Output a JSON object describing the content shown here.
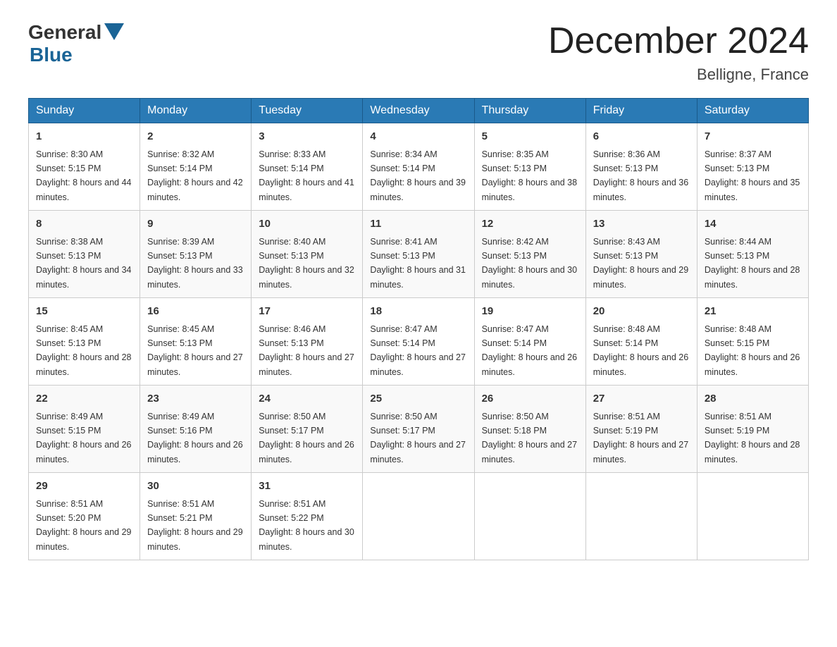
{
  "logo": {
    "general": "General",
    "blue": "Blue"
  },
  "header": {
    "title": "December 2024",
    "subtitle": "Belligne, France"
  },
  "days_of_week": [
    "Sunday",
    "Monday",
    "Tuesday",
    "Wednesday",
    "Thursday",
    "Friday",
    "Saturday"
  ],
  "weeks": [
    [
      {
        "day": "1",
        "sunrise": "Sunrise: 8:30 AM",
        "sunset": "Sunset: 5:15 PM",
        "daylight": "Daylight: 8 hours and 44 minutes."
      },
      {
        "day": "2",
        "sunrise": "Sunrise: 8:32 AM",
        "sunset": "Sunset: 5:14 PM",
        "daylight": "Daylight: 8 hours and 42 minutes."
      },
      {
        "day": "3",
        "sunrise": "Sunrise: 8:33 AM",
        "sunset": "Sunset: 5:14 PM",
        "daylight": "Daylight: 8 hours and 41 minutes."
      },
      {
        "day": "4",
        "sunrise": "Sunrise: 8:34 AM",
        "sunset": "Sunset: 5:14 PM",
        "daylight": "Daylight: 8 hours and 39 minutes."
      },
      {
        "day": "5",
        "sunrise": "Sunrise: 8:35 AM",
        "sunset": "Sunset: 5:13 PM",
        "daylight": "Daylight: 8 hours and 38 minutes."
      },
      {
        "day": "6",
        "sunrise": "Sunrise: 8:36 AM",
        "sunset": "Sunset: 5:13 PM",
        "daylight": "Daylight: 8 hours and 36 minutes."
      },
      {
        "day": "7",
        "sunrise": "Sunrise: 8:37 AM",
        "sunset": "Sunset: 5:13 PM",
        "daylight": "Daylight: 8 hours and 35 minutes."
      }
    ],
    [
      {
        "day": "8",
        "sunrise": "Sunrise: 8:38 AM",
        "sunset": "Sunset: 5:13 PM",
        "daylight": "Daylight: 8 hours and 34 minutes."
      },
      {
        "day": "9",
        "sunrise": "Sunrise: 8:39 AM",
        "sunset": "Sunset: 5:13 PM",
        "daylight": "Daylight: 8 hours and 33 minutes."
      },
      {
        "day": "10",
        "sunrise": "Sunrise: 8:40 AM",
        "sunset": "Sunset: 5:13 PM",
        "daylight": "Daylight: 8 hours and 32 minutes."
      },
      {
        "day": "11",
        "sunrise": "Sunrise: 8:41 AM",
        "sunset": "Sunset: 5:13 PM",
        "daylight": "Daylight: 8 hours and 31 minutes."
      },
      {
        "day": "12",
        "sunrise": "Sunrise: 8:42 AM",
        "sunset": "Sunset: 5:13 PM",
        "daylight": "Daylight: 8 hours and 30 minutes."
      },
      {
        "day": "13",
        "sunrise": "Sunrise: 8:43 AM",
        "sunset": "Sunset: 5:13 PM",
        "daylight": "Daylight: 8 hours and 29 minutes."
      },
      {
        "day": "14",
        "sunrise": "Sunrise: 8:44 AM",
        "sunset": "Sunset: 5:13 PM",
        "daylight": "Daylight: 8 hours and 28 minutes."
      }
    ],
    [
      {
        "day": "15",
        "sunrise": "Sunrise: 8:45 AM",
        "sunset": "Sunset: 5:13 PM",
        "daylight": "Daylight: 8 hours and 28 minutes."
      },
      {
        "day": "16",
        "sunrise": "Sunrise: 8:45 AM",
        "sunset": "Sunset: 5:13 PM",
        "daylight": "Daylight: 8 hours and 27 minutes."
      },
      {
        "day": "17",
        "sunrise": "Sunrise: 8:46 AM",
        "sunset": "Sunset: 5:13 PM",
        "daylight": "Daylight: 8 hours and 27 minutes."
      },
      {
        "day": "18",
        "sunrise": "Sunrise: 8:47 AM",
        "sunset": "Sunset: 5:14 PM",
        "daylight": "Daylight: 8 hours and 27 minutes."
      },
      {
        "day": "19",
        "sunrise": "Sunrise: 8:47 AM",
        "sunset": "Sunset: 5:14 PM",
        "daylight": "Daylight: 8 hours and 26 minutes."
      },
      {
        "day": "20",
        "sunrise": "Sunrise: 8:48 AM",
        "sunset": "Sunset: 5:14 PM",
        "daylight": "Daylight: 8 hours and 26 minutes."
      },
      {
        "day": "21",
        "sunrise": "Sunrise: 8:48 AM",
        "sunset": "Sunset: 5:15 PM",
        "daylight": "Daylight: 8 hours and 26 minutes."
      }
    ],
    [
      {
        "day": "22",
        "sunrise": "Sunrise: 8:49 AM",
        "sunset": "Sunset: 5:15 PM",
        "daylight": "Daylight: 8 hours and 26 minutes."
      },
      {
        "day": "23",
        "sunrise": "Sunrise: 8:49 AM",
        "sunset": "Sunset: 5:16 PM",
        "daylight": "Daylight: 8 hours and 26 minutes."
      },
      {
        "day": "24",
        "sunrise": "Sunrise: 8:50 AM",
        "sunset": "Sunset: 5:17 PM",
        "daylight": "Daylight: 8 hours and 26 minutes."
      },
      {
        "day": "25",
        "sunrise": "Sunrise: 8:50 AM",
        "sunset": "Sunset: 5:17 PM",
        "daylight": "Daylight: 8 hours and 27 minutes."
      },
      {
        "day": "26",
        "sunrise": "Sunrise: 8:50 AM",
        "sunset": "Sunset: 5:18 PM",
        "daylight": "Daylight: 8 hours and 27 minutes."
      },
      {
        "day": "27",
        "sunrise": "Sunrise: 8:51 AM",
        "sunset": "Sunset: 5:19 PM",
        "daylight": "Daylight: 8 hours and 27 minutes."
      },
      {
        "day": "28",
        "sunrise": "Sunrise: 8:51 AM",
        "sunset": "Sunset: 5:19 PM",
        "daylight": "Daylight: 8 hours and 28 minutes."
      }
    ],
    [
      {
        "day": "29",
        "sunrise": "Sunrise: 8:51 AM",
        "sunset": "Sunset: 5:20 PM",
        "daylight": "Daylight: 8 hours and 29 minutes."
      },
      {
        "day": "30",
        "sunrise": "Sunrise: 8:51 AM",
        "sunset": "Sunset: 5:21 PM",
        "daylight": "Daylight: 8 hours and 29 minutes."
      },
      {
        "day": "31",
        "sunrise": "Sunrise: 8:51 AM",
        "sunset": "Sunset: 5:22 PM",
        "daylight": "Daylight: 8 hours and 30 minutes."
      },
      null,
      null,
      null,
      null
    ]
  ]
}
